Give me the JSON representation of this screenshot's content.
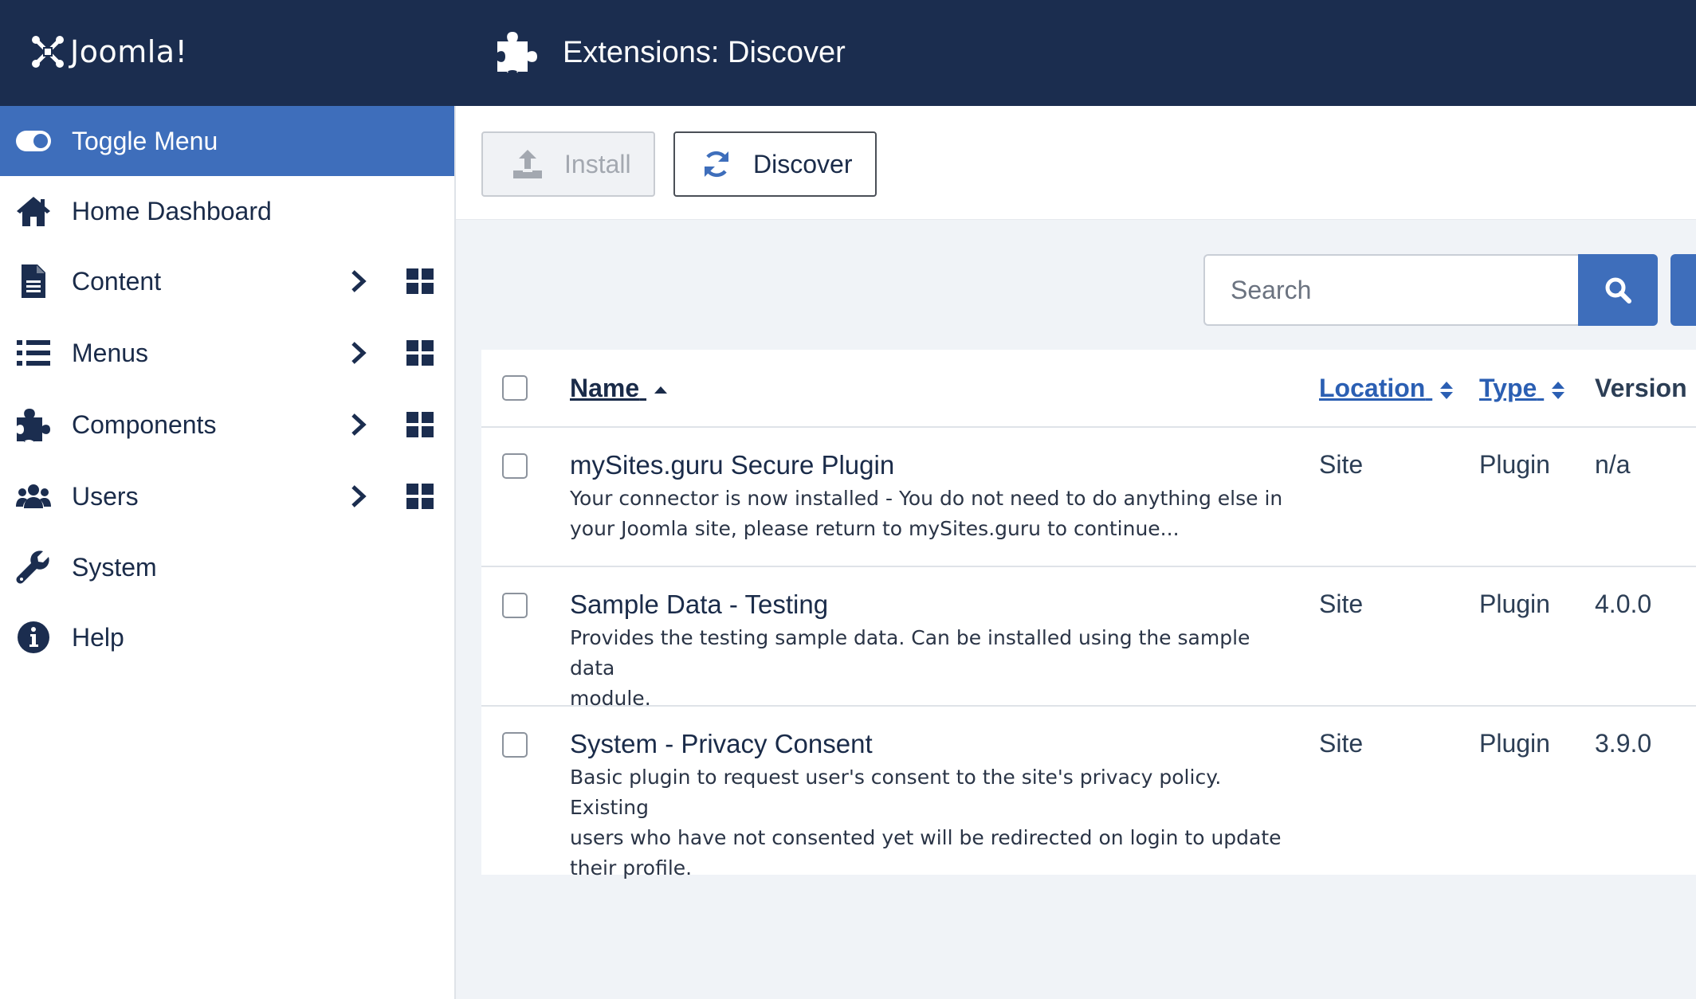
{
  "header": {
    "logo_text": "Joomla!",
    "title": "Extensions: Discover"
  },
  "sidebar": {
    "items": [
      {
        "label": "Toggle Menu",
        "icon": "toggle-icon",
        "active": true
      },
      {
        "label": "Home Dashboard",
        "icon": "home-icon"
      },
      {
        "label": "Content",
        "icon": "file-icon",
        "has_submenu": true
      },
      {
        "label": "Menus",
        "icon": "list-icon",
        "has_submenu": true
      },
      {
        "label": "Components",
        "icon": "puzzle-icon",
        "has_submenu": true
      },
      {
        "label": "Users",
        "icon": "users-icon",
        "has_submenu": true
      },
      {
        "label": "System",
        "icon": "wrench-icon"
      },
      {
        "label": "Help",
        "icon": "info-icon"
      }
    ]
  },
  "toolbar": {
    "install_label": "Install",
    "discover_label": "Discover"
  },
  "search": {
    "placeholder": "Search",
    "value": ""
  },
  "table": {
    "columns": {
      "name": "Name",
      "location": "Location",
      "type": "Type",
      "version": "Version"
    },
    "rows": [
      {
        "name": "mySites.guru Secure Plugin",
        "description_line1": "Your connector is now installed - You do not need to do anything else in",
        "description_line2": "your Joomla site, please return to mySites.guru to continue...",
        "description_line3": "",
        "location": "Site",
        "type": "Plugin",
        "version": "n/a"
      },
      {
        "name": "Sample Data - Testing",
        "description_line1": "Provides the testing sample data. Can be installed using the sample data",
        "description_line2": "module.",
        "description_line3": "",
        "location": "Site",
        "type": "Plugin",
        "version": "4.0.0"
      },
      {
        "name": "System - Privacy Consent",
        "description_line1": "Basic plugin to request user's consent to the site's privacy policy. Existing",
        "description_line2": "users who have not consented yet will be redirected on login to update",
        "description_line3": "their profile.",
        "location": "Site",
        "type": "Plugin",
        "version": "3.9.0"
      }
    ]
  },
  "colors": {
    "header_bg": "#1b2d4f",
    "accent": "#3e6ebb",
    "link": "#2b5fb3"
  }
}
